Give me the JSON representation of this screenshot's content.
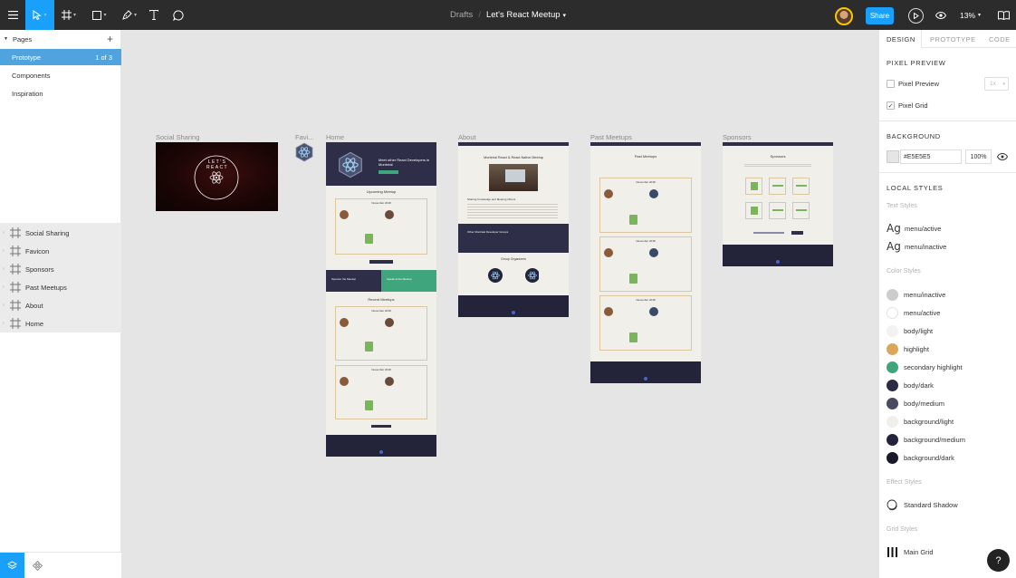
{
  "toolbar": {
    "breadcrumb_parent": "Drafts",
    "breadcrumb_sep": "/",
    "file_name": "Let's React Meetup",
    "file_caret": "⌄",
    "share_label": "Share",
    "zoom_label": "13%",
    "icons": [
      "hamburger-icon",
      "move-icon",
      "frame-icon",
      "shape-icon",
      "pen-icon",
      "text-icon",
      "comment-icon",
      "play-icon",
      "eye-icon",
      "book-icon"
    ]
  },
  "left_panel": {
    "pages_header": "Pages",
    "add_label": "+",
    "pages": [
      {
        "label": "Prototype",
        "count": "1 of 3"
      },
      {
        "label": "Components"
      },
      {
        "label": "Inspiration"
      }
    ],
    "layers": [
      "Social Sharing",
      "Favicon",
      "Sponsors",
      "Past Meetups",
      "About",
      "Home"
    ]
  },
  "canvas": {
    "background": "#E5E5E5",
    "frames": {
      "social_sharing": {
        "label": "Social Sharing",
        "text": "LET'S REACT"
      },
      "favicon": {
        "label": "Favi..."
      },
      "home": {
        "label": "Home",
        "hero_text": "Meet other React Developers in Montréal",
        "upcoming_title": "Upcoming Meetup",
        "upcoming_date": "November 2018",
        "sponsor_text": "Sponsor the Meetup",
        "speak_text": "Speak at the Meetup",
        "recent_title": "Recent Meetups",
        "recent_dates": [
          "November 2018",
          "November 2018"
        ]
      },
      "about": {
        "label": "About",
        "title": "Montréal React & React Native Meetup",
        "section1": "Sharing Knowledge and Meeting Others",
        "section2": "Other Montréal Developer Groups",
        "organizers_title": "Group Organizers"
      },
      "past_meetups": {
        "label": "Past Meetups",
        "title": "Past Meetups",
        "dates": [
          "November 2018",
          "November 2018",
          "November 2018"
        ]
      },
      "sponsors": {
        "label": "Sponsors",
        "title": "Sponsors"
      }
    }
  },
  "right_panel": {
    "tabs": [
      "DESIGN",
      "PROTOTYPE",
      "CODE"
    ],
    "pixel_preview_title": "PIXEL PREVIEW",
    "pixel_preview_label": "Pixel Preview",
    "pixel_grid_label": "Pixel Grid",
    "pixel_grid_checked": "✓",
    "scale_value": "1x",
    "background_title": "BACKGROUND",
    "background_hex": "#E5E5E5",
    "background_opacity": "100%",
    "local_styles_title": "LOCAL STYLES",
    "text_styles_label": "Text Styles",
    "text_styles": [
      {
        "glyph": "Ag",
        "name": "menu/active"
      },
      {
        "glyph": "Ag",
        "name": "menu/inactive"
      }
    ],
    "color_styles_label": "Color Styles",
    "color_styles": [
      {
        "name": "menu/inactive",
        "color": "#CCCCCC"
      },
      {
        "name": "menu/active",
        "color": "#FFFFFF"
      },
      {
        "name": "body/light",
        "color": "#F2F2F2"
      },
      {
        "name": "highlight",
        "color": "#DBA859"
      },
      {
        "name": "secondary highlight",
        "color": "#3FA57C"
      },
      {
        "name": "body/dark",
        "color": "#2B2B44"
      },
      {
        "name": "body/medium",
        "color": "#494960"
      },
      {
        "name": "background/light",
        "color": "#F1EFE9"
      },
      {
        "name": "background/medium",
        "color": "#23233A"
      },
      {
        "name": "background/dark",
        "color": "#1A1A2B"
      }
    ],
    "effect_styles_label": "Effect Styles",
    "effect_styles": [
      "Standard Shadow"
    ],
    "grid_styles_label": "Grid Styles",
    "grid_styles": [
      "Main Grid"
    ],
    "help_label": "?"
  }
}
